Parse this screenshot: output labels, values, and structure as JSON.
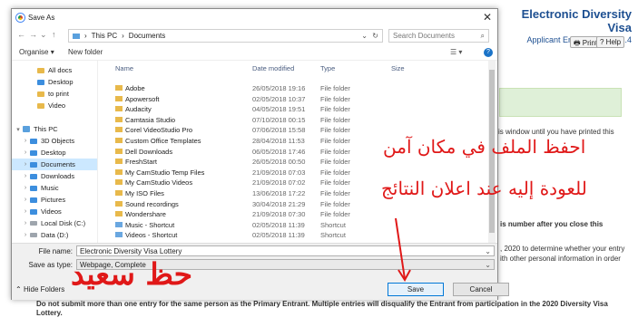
{
  "background": {
    "site_title": "Electronic Diversity Visa",
    "site_subtitle": "Applicant Entry System: 12.4",
    "print_label": "Print",
    "help_label": "Help",
    "text_printed": "is window until you have printed this",
    "text_number": "is number after you close this",
    "text_2020": ", 2020 to determine whether your entry",
    "text_personal": "ith other personal information in order",
    "text_footer1": "Do not submit more than one entry for the same person as the Primary Entrant. Multiple entries will disqualify the Entrant from participation in the 2020 Diversity Visa",
    "text_footer2": "Lottery."
  },
  "dialog": {
    "title": "Save As",
    "breadcrumb": [
      "This PC",
      "Documents"
    ],
    "search_placeholder": "Search Documents",
    "organise_label": "Organise",
    "new_folder_label": "New folder",
    "nav_items": [
      {
        "label": "All docs",
        "icon": "folder-icon",
        "indent": 2,
        "caret": ""
      },
      {
        "label": "Desktop",
        "icon": "desktop-icon",
        "indent": 2,
        "caret": ""
      },
      {
        "label": "to print",
        "icon": "folder-icon",
        "indent": 2,
        "caret": ""
      },
      {
        "label": "Video",
        "icon": "folder-icon",
        "indent": 2,
        "caret": ""
      },
      {
        "label": "",
        "icon": "",
        "indent": 0,
        "caret": ""
      },
      {
        "label": "This PC",
        "icon": "pc-icon",
        "indent": 0,
        "caret": "▾"
      },
      {
        "label": "3D Objects",
        "icon": "cube-icon",
        "indent": 1,
        "caret": "›"
      },
      {
        "label": "Desktop",
        "icon": "desktop-icon",
        "indent": 1,
        "caret": "›"
      },
      {
        "label": "Documents",
        "icon": "documents-icon",
        "indent": 1,
        "caret": "›"
      },
      {
        "label": "Downloads",
        "icon": "downloads-icon",
        "indent": 1,
        "caret": "›"
      },
      {
        "label": "Music",
        "icon": "music-icon",
        "indent": 1,
        "caret": "›"
      },
      {
        "label": "Pictures",
        "icon": "pictures-icon",
        "indent": 1,
        "caret": "›"
      },
      {
        "label": "Videos",
        "icon": "videos-icon",
        "indent": 1,
        "caret": "›"
      },
      {
        "label": "Local Disk (C:)",
        "icon": "drive-icon",
        "indent": 1,
        "caret": "›"
      },
      {
        "label": "Data (D:)",
        "icon": "drive-icon",
        "indent": 1,
        "caret": "›"
      }
    ],
    "selected_nav": 8,
    "columns": [
      "Name",
      "Date modified",
      "Type",
      "Size"
    ],
    "files": [
      {
        "name": "Adobe",
        "date": "26/05/2018 19:16",
        "type": "File folder",
        "icon": "folder-icon"
      },
      {
        "name": "Apowersoft",
        "date": "02/05/2018 10:37",
        "type": "File folder",
        "icon": "folder-icon"
      },
      {
        "name": "Audacity",
        "date": "04/05/2018 19:51",
        "type": "File folder",
        "icon": "folder-icon"
      },
      {
        "name": "Camtasia Studio",
        "date": "07/10/2018 00:15",
        "type": "File folder",
        "icon": "folder-icon"
      },
      {
        "name": "Corel VideoStudio Pro",
        "date": "07/06/2018 15:58",
        "type": "File folder",
        "icon": "folder-icon"
      },
      {
        "name": "Custom Office Templates",
        "date": "28/04/2018 11:53",
        "type": "File folder",
        "icon": "folder-icon"
      },
      {
        "name": "Dell Downloads",
        "date": "06/05/2018 17:46",
        "type": "File folder",
        "icon": "folder-icon"
      },
      {
        "name": "FreshStart",
        "date": "26/05/2018 00:50",
        "type": "File folder",
        "icon": "folder-icon"
      },
      {
        "name": "My CamStudio Temp Files",
        "date": "21/09/2018 07:03",
        "type": "File folder",
        "icon": "folder-icon"
      },
      {
        "name": "My CamStudio Videos",
        "date": "21/09/2018 07:02",
        "type": "File folder",
        "icon": "folder-icon"
      },
      {
        "name": "My ISO Files",
        "date": "13/06/2018 17:22",
        "type": "File folder",
        "icon": "folder-icon"
      },
      {
        "name": "Sound recordings",
        "date": "30/04/2018 21:29",
        "type": "File folder",
        "icon": "folder-icon"
      },
      {
        "name": "Wondershare",
        "date": "21/09/2018 07:30",
        "type": "File folder",
        "icon": "folder-icon"
      },
      {
        "name": "Music - Shortcut",
        "date": "02/05/2018 11:39",
        "type": "Shortcut",
        "icon": "shortcut-icon"
      },
      {
        "name": "Videos - Shortcut",
        "date": "02/05/2018 11:39",
        "type": "Shortcut",
        "icon": "shortcut-icon"
      }
    ],
    "file_name_label": "File name:",
    "file_name_value": "Electronic Diversity Visa Lottery",
    "save_type_label": "Save as type:",
    "save_type_value": "Webpage, Complete",
    "hide_folders_label": "Hide Folders",
    "save_label": "Save",
    "cancel_label": "Cancel"
  },
  "annotations": {
    "line1": "احفظ الملف في مكان آمن",
    "line2": "للعودة إليه عند اعلان النتائج",
    "line3": "حظ سعيد",
    "color": "#e01818"
  }
}
